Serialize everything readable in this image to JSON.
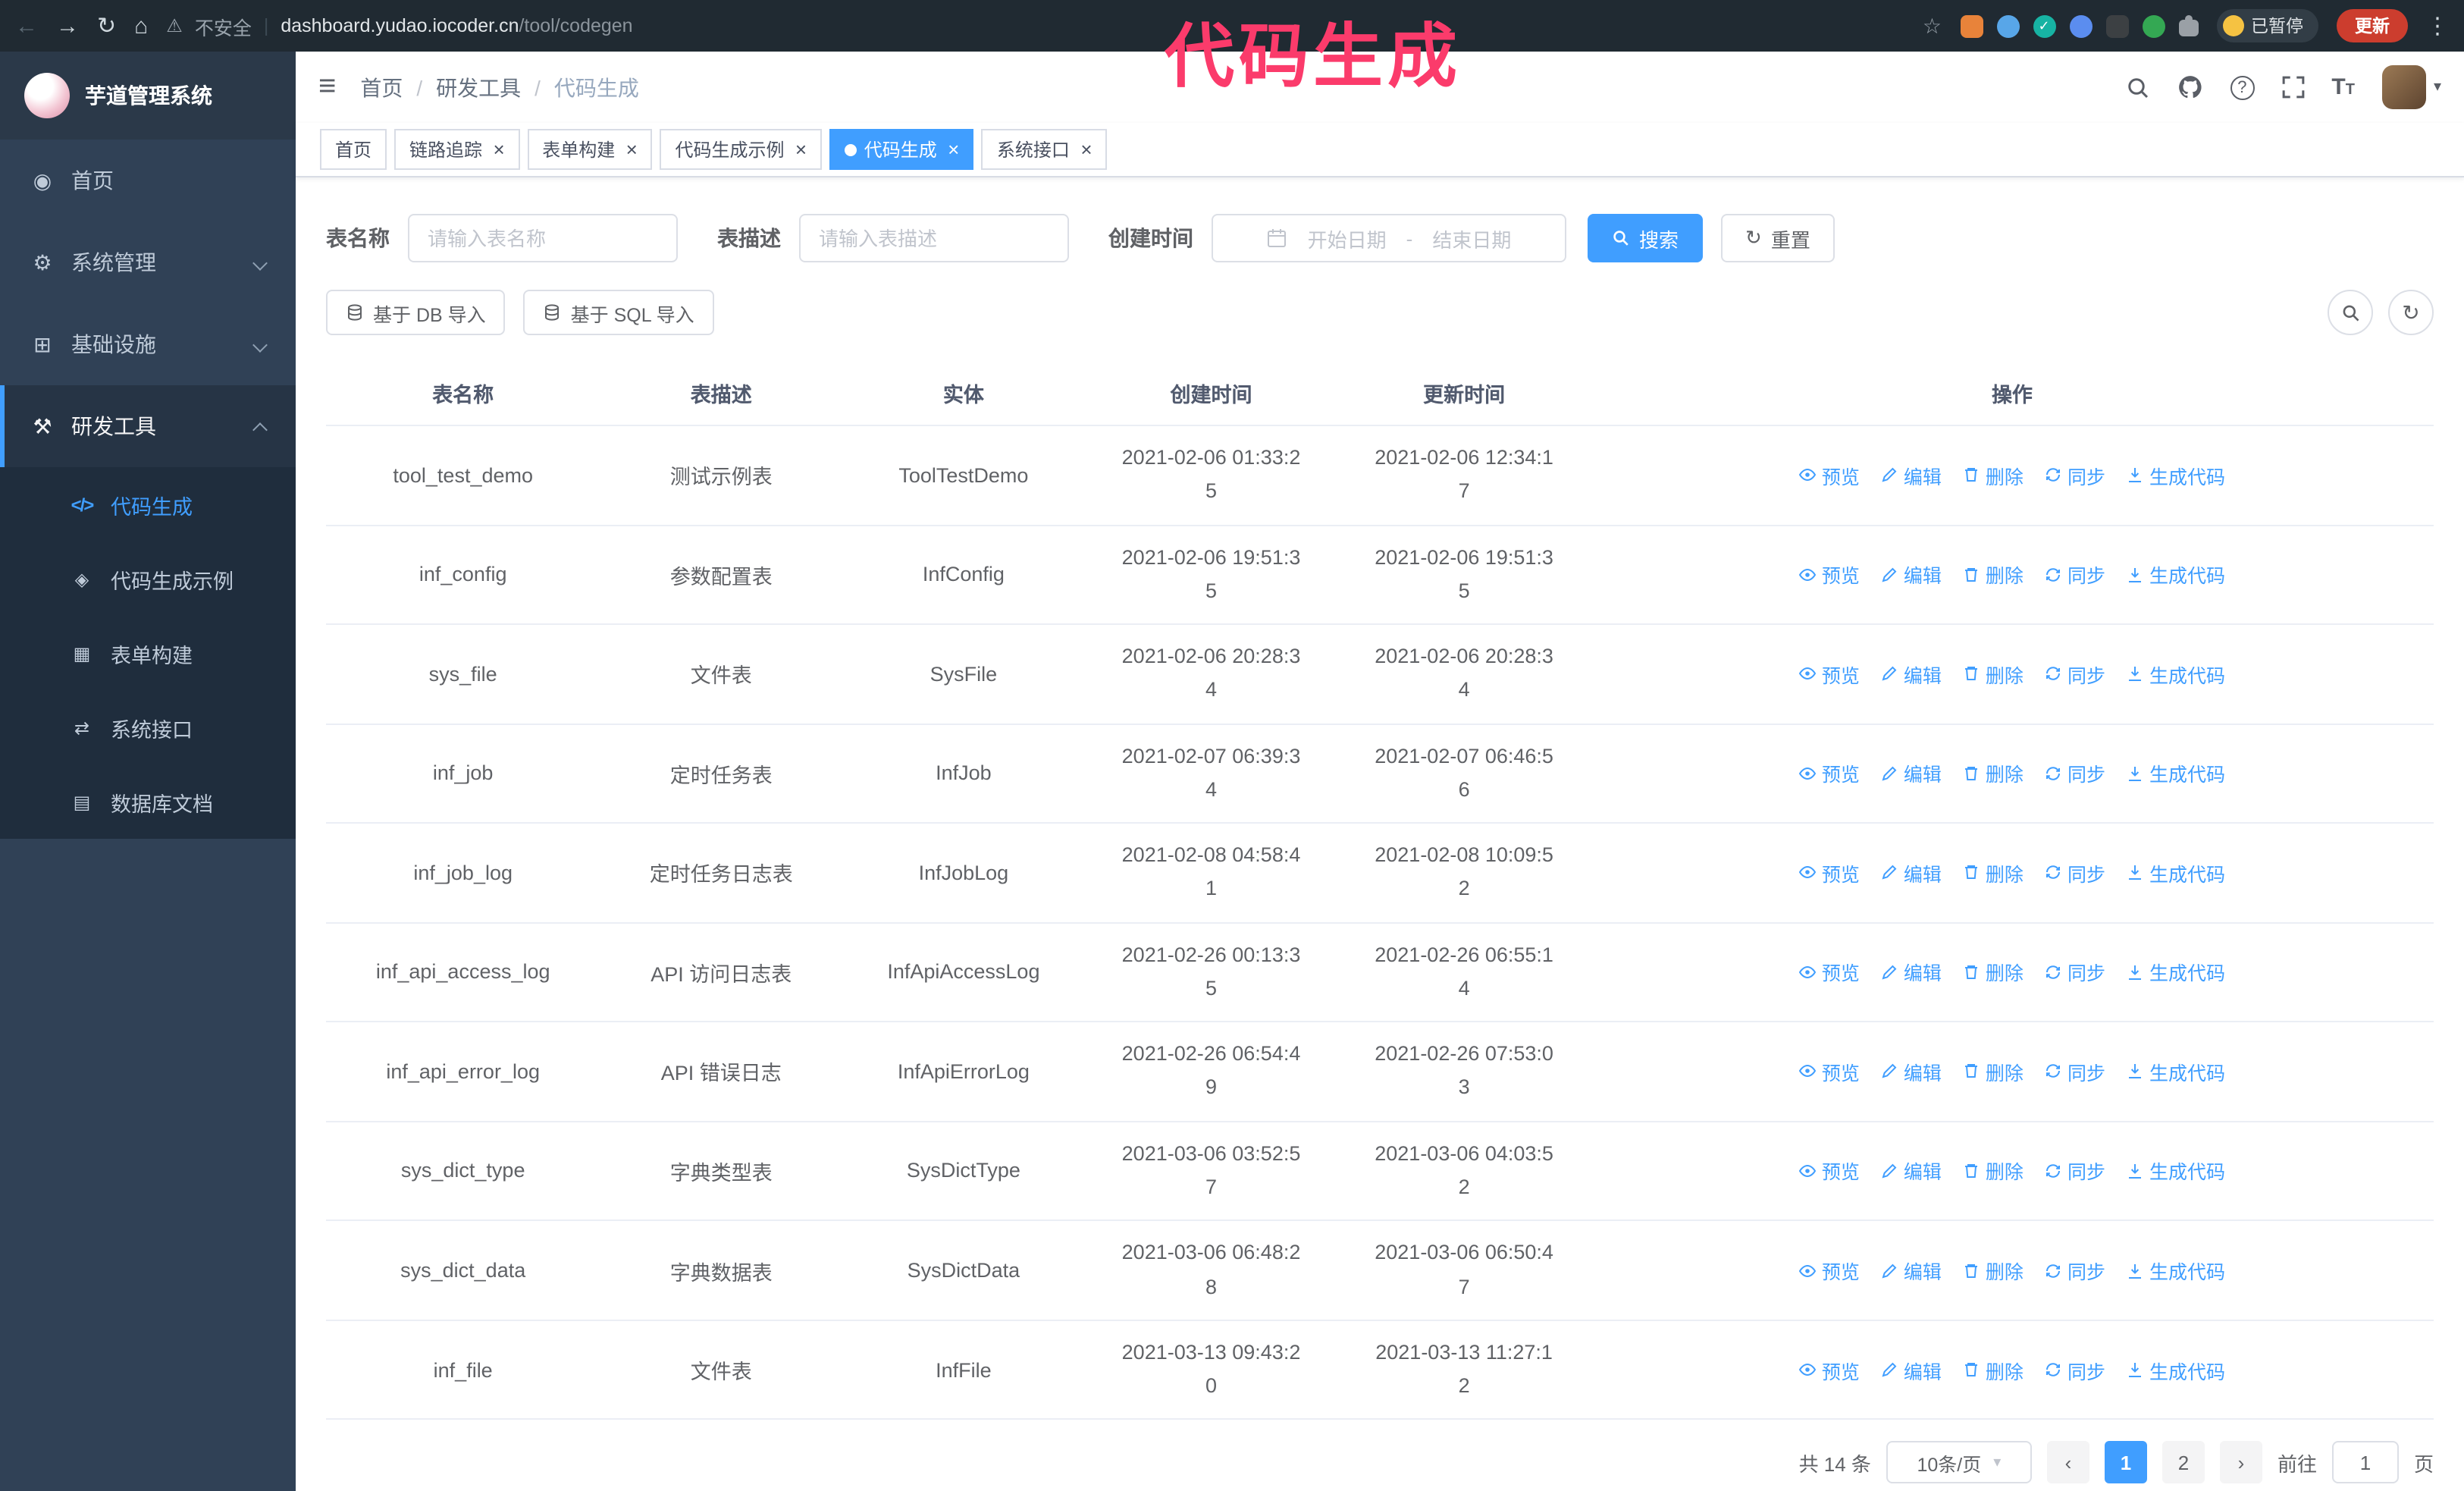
{
  "theme": {
    "accent": "#409eff",
    "sidebar_bg": "#304156",
    "annotation_color": "#fb3b6b",
    "tab_active_bg": "#409eff"
  },
  "browser": {
    "security_label": "不安全",
    "url_host": "dashboard.yudao.iocoder.cn",
    "url_path": "/tool/codegen",
    "paused_badge": "已暂停",
    "update_button": "更新"
  },
  "annotation": {
    "text": "代码生成"
  },
  "sidebar": {
    "title": "芋道管理系统",
    "items": [
      {
        "label": "首页",
        "icon": "dashboard-icon"
      },
      {
        "label": "系统管理",
        "icon": "gear-icon",
        "expandable": true
      },
      {
        "label": "基础设施",
        "icon": "infrastructure-icon",
        "expandable": true
      },
      {
        "label": "研发工具",
        "icon": "tools-icon",
        "expandable": true,
        "expanded": true
      }
    ],
    "submenu": [
      {
        "label": "代码生成",
        "icon": "code-icon",
        "active": true
      },
      {
        "label": "代码生成示例",
        "icon": "example-badge-icon"
      },
      {
        "label": "表单构建",
        "icon": "form-grid-icon"
      },
      {
        "label": "系统接口",
        "icon": "api-swap-icon"
      },
      {
        "label": "数据库文档",
        "icon": "database-doc-icon"
      }
    ]
  },
  "header": {
    "breadcrumb": [
      "首页",
      "研发工具",
      "代码生成"
    ],
    "icons": [
      "search-icon",
      "github-icon",
      "help-icon",
      "fullscreen-icon",
      "font-size-icon",
      "avatar",
      "chevron-down-icon"
    ]
  },
  "tabs": [
    {
      "label": "首页",
      "closable": false,
      "active": false
    },
    {
      "label": "链路追踪",
      "closable": true,
      "active": false
    },
    {
      "label": "表单构建",
      "closable": true,
      "active": false
    },
    {
      "label": "代码生成示例",
      "closable": true,
      "active": false
    },
    {
      "label": "代码生成",
      "closable": true,
      "active": true
    },
    {
      "label": "系统接口",
      "closable": true,
      "active": false
    }
  ],
  "filters": {
    "table_name_label": "表名称",
    "table_name_placeholder": "请输入表名称",
    "table_desc_label": "表描述",
    "table_desc_placeholder": "请输入表描述",
    "create_time_label": "创建时间",
    "date_start_placeholder": "开始日期",
    "date_separator": "-",
    "date_end_placeholder": "结束日期",
    "search_button": "搜索",
    "reset_button": "重置"
  },
  "toolbar": {
    "import_db_button": "基于 DB 导入",
    "import_sql_button": "基于 SQL 导入",
    "right_icons": [
      "search-toggle-icon",
      "refresh-icon"
    ]
  },
  "table": {
    "columns": [
      "表名称",
      "表描述",
      "实体",
      "创建时间",
      "更新时间",
      "操作"
    ],
    "actions": [
      "预览",
      "编辑",
      "删除",
      "同步",
      "生成代码"
    ],
    "action_icons": [
      "eye-icon",
      "edit-pencil-icon",
      "delete-trash-icon",
      "sync-icon",
      "code-download-icon"
    ],
    "rows": [
      {
        "name": "tool_test_demo",
        "desc": "测试示例表",
        "entity": "ToolTestDemo",
        "created": "2021-02-06 01:33:25",
        "updated": "2021-02-06 12:34:17"
      },
      {
        "name": "inf_config",
        "desc": "参数配置表",
        "entity": "InfConfig",
        "created": "2021-02-06 19:51:35",
        "updated": "2021-02-06 19:51:35"
      },
      {
        "name": "sys_file",
        "desc": "文件表",
        "entity": "SysFile",
        "created": "2021-02-06 20:28:34",
        "updated": "2021-02-06 20:28:34"
      },
      {
        "name": "inf_job",
        "desc": "定时任务表",
        "entity": "InfJob",
        "created": "2021-02-07 06:39:34",
        "updated": "2021-02-07 06:46:56"
      },
      {
        "name": "inf_job_log",
        "desc": "定时任务日志表",
        "entity": "InfJobLog",
        "created": "2021-02-08 04:58:41",
        "updated": "2021-02-08 10:09:52"
      },
      {
        "name": "inf_api_access_log",
        "desc": "API 访问日志表",
        "entity": "InfApiAccessLog",
        "created": "2021-02-26 00:13:35",
        "updated": "2021-02-26 06:55:14"
      },
      {
        "name": "inf_api_error_log",
        "desc": "API 错误日志",
        "entity": "InfApiErrorLog",
        "created": "2021-02-26 06:54:49",
        "updated": "2021-02-26 07:53:03"
      },
      {
        "name": "sys_dict_type",
        "desc": "字典类型表",
        "entity": "SysDictType",
        "created": "2021-03-06 03:52:57",
        "updated": "2021-03-06 04:03:52"
      },
      {
        "name": "sys_dict_data",
        "desc": "字典数据表",
        "entity": "SysDictData",
        "created": "2021-03-06 06:48:28",
        "updated": "2021-03-06 06:50:47"
      },
      {
        "name": "inf_file",
        "desc": "文件表",
        "entity": "InfFile",
        "created": "2021-03-13 09:43:20",
        "updated": "2021-03-13 11:27:12"
      }
    ]
  },
  "pagination": {
    "total": "共 14 条",
    "page_size": "10条/页",
    "pages": [
      "1",
      "2"
    ],
    "goto_prefix": "前往",
    "goto_value": "1",
    "goto_suffix": "页"
  }
}
